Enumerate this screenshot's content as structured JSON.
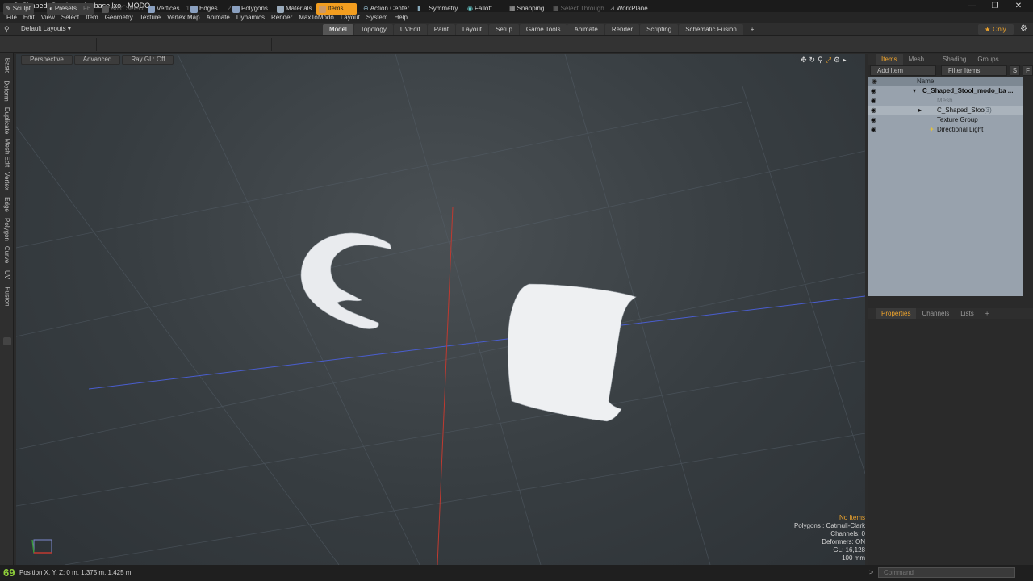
{
  "window": {
    "title": "C_Shaped_Stool_modo_base.lxo - MODO",
    "minimize": "—",
    "maximize": "❐",
    "close": "✕"
  },
  "menu": [
    "File",
    "Edit",
    "View",
    "Select",
    "Item",
    "Geometry",
    "Texture",
    "Vertex Map",
    "Animate",
    "Dynamics",
    "Render",
    "MaxToModo",
    "Layout",
    "System",
    "Help"
  ],
  "layout": {
    "preset": "Default Layouts ▾",
    "only": "Only",
    "tabs": [
      "Model",
      "Topology",
      "UVEdit",
      "Paint",
      "Layout",
      "Setup",
      "Game Tools",
      "Animate",
      "Render",
      "Scripting",
      "Schematic Fusion"
    ],
    "active_tab": "Model",
    "add": "+"
  },
  "toolbar": {
    "sculpt": "Sculpt",
    "presets": "Presets",
    "presets_key": "F6",
    "auto_select": "Auto Select",
    "vertices": "Vertices",
    "vertices_key": "1",
    "edges": "Edges",
    "edges_key": "2",
    "polygons": "Polygons",
    "materials": "Materials",
    "items": "Items",
    "action_center": "Action Center",
    "symmetry": "Symmetry",
    "falloff": "Falloff",
    "snapping": "Snapping",
    "select_through": "Select Through",
    "workplane": "WorkPlane"
  },
  "left_tabs": [
    "Basic",
    "Deform",
    "Duplicate",
    "Mesh Edit",
    "Vertex",
    "Edge",
    "Polygon",
    "Curve",
    "UV",
    "Fusion"
  ],
  "viewport": {
    "perspective": "Perspective",
    "advanced": "Advanced",
    "raygl": "Ray GL: Off",
    "info": {
      "no_items": "No Items",
      "polygons": "Polygons : Catmull-Clark",
      "channels": "Channels: 0",
      "deformers": "Deformers: ON",
      "gl": "GL: 16,128",
      "scale": "100 mm"
    }
  },
  "right_panel": {
    "tabs": [
      "Items",
      "Mesh ...",
      "Shading",
      "Groups"
    ],
    "add_item": "Add Item",
    "filter_items": "Filter Items",
    "s_btn": "S",
    "f_btn": "F",
    "name_header": "Name",
    "tree": [
      {
        "label": "C_Shaped_Stool_modo_ba ..."
      },
      {
        "label": "Mesh"
      },
      {
        "label": "C_Shaped_Stool",
        "count": "(3)"
      },
      {
        "label": "Texture Group"
      },
      {
        "label": "Directional Light"
      }
    ],
    "prop_tabs": [
      "Properties",
      "Channels",
      "Lists"
    ],
    "prop_add": "+"
  },
  "status": {
    "fps": "69",
    "position": "Position X, Y, Z:   0 m, 1.375 m, 1.425 m",
    "command_placeholder": "Command",
    "arrow": ">"
  }
}
